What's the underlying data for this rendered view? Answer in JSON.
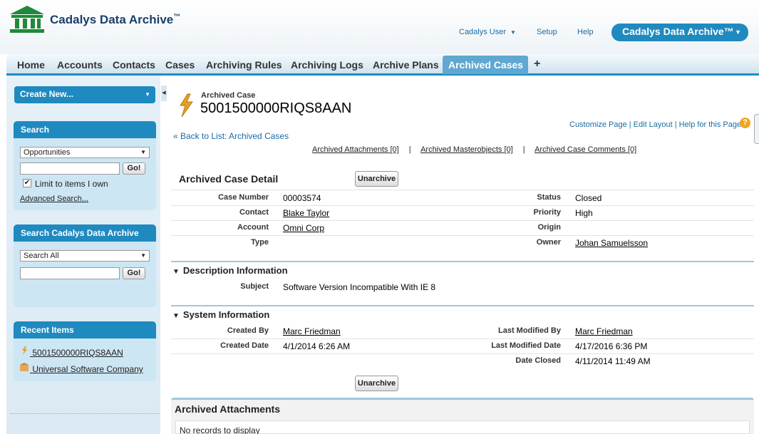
{
  "app": {
    "logo_text": "Cadalys Data Archive",
    "logo_tm": "™",
    "accent": "#1f8ac0"
  },
  "header": {
    "user_menu": "Cadalys User",
    "setup": "Setup",
    "help": "Help",
    "app_switcher": "Cadalys Data Archive™"
  },
  "tabs": [
    {
      "label": "Home"
    },
    {
      "label": "Accounts"
    },
    {
      "label": "Contacts"
    },
    {
      "label": "Cases"
    },
    {
      "label": "Archiving Rules"
    },
    {
      "label": "Archiving Logs"
    },
    {
      "label": "Archive Plans"
    },
    {
      "label": "Archived Cases",
      "active": true
    },
    {
      "label": "+"
    }
  ],
  "sidebar": {
    "create_new": "Create New...",
    "search": {
      "title": "Search",
      "scope": "Opportunities",
      "query": "",
      "go": "Go!",
      "limit_label": "Limit to items I own",
      "limit_checked": true,
      "checkmark": "✔",
      "advanced": "Advanced Search..."
    },
    "archive_search": {
      "title": "Search Cadalys Data Archive",
      "scope": "Search All",
      "query": "",
      "go": "Go!"
    },
    "recent": {
      "title": "Recent Items",
      "items": [
        {
          "label": "5001500000RIQS8AAN",
          "icon": "case-icon"
        },
        {
          "label": "Universal Software Company",
          "icon": "account-icon"
        }
      ]
    }
  },
  "record": {
    "type_label": "Archived Case",
    "title": "5001500000RIQS8AAN",
    "page_links": "Customize Page | Edit Layout | Help for this Page",
    "help_glyph": "?",
    "back_link": "« Back to List: Archived Cases",
    "related": [
      {
        "label": "Archived Attachments",
        "count": "[0]"
      },
      {
        "label": "Archived Masterobjects",
        "count": "[0]"
      },
      {
        "label": "Archived Case Comments",
        "count": "[0]"
      }
    ],
    "related_sep": "|"
  },
  "detail": {
    "title": "Archived Case Detail",
    "unarchive": "Unarchive",
    "fields": {
      "case_number": {
        "label": "Case Number",
        "value": "00003574"
      },
      "contact": {
        "label": "Contact",
        "value": "Blake Taylor"
      },
      "account": {
        "label": "Account",
        "value": "Omni Corp"
      },
      "type": {
        "label": "Type",
        "value": ""
      },
      "status": {
        "label": "Status",
        "value": "Closed"
      },
      "priority": {
        "label": "Priority",
        "value": "High"
      },
      "origin": {
        "label": "Origin",
        "value": ""
      },
      "owner": {
        "label": "Owner",
        "value": "Johan Samuelsson"
      }
    }
  },
  "description": {
    "title": "Description Information",
    "subject": {
      "label": "Subject",
      "value": "Software Version Incompatible With IE 8"
    }
  },
  "system": {
    "title": "System Information",
    "created_by": {
      "label": "Created By",
      "value": "Marc Friedman"
    },
    "created_date": {
      "label": "Created Date",
      "value": "4/1/2014 6:26 AM"
    },
    "last_modified_by": {
      "label": "Last Modified By",
      "value": "Marc Friedman"
    },
    "last_modified_date": {
      "label": "Last Modified Date",
      "value": "4/17/2016 6:36 PM"
    },
    "date_closed": {
      "label": "Date Closed",
      "value": "4/11/2014 11:49 AM"
    }
  },
  "attachments": {
    "title": "Archived Attachments",
    "empty": "No records to display"
  },
  "glyphs": {
    "caret_down": "▼",
    "collapse_left": "◀",
    "section_open": "▼"
  }
}
